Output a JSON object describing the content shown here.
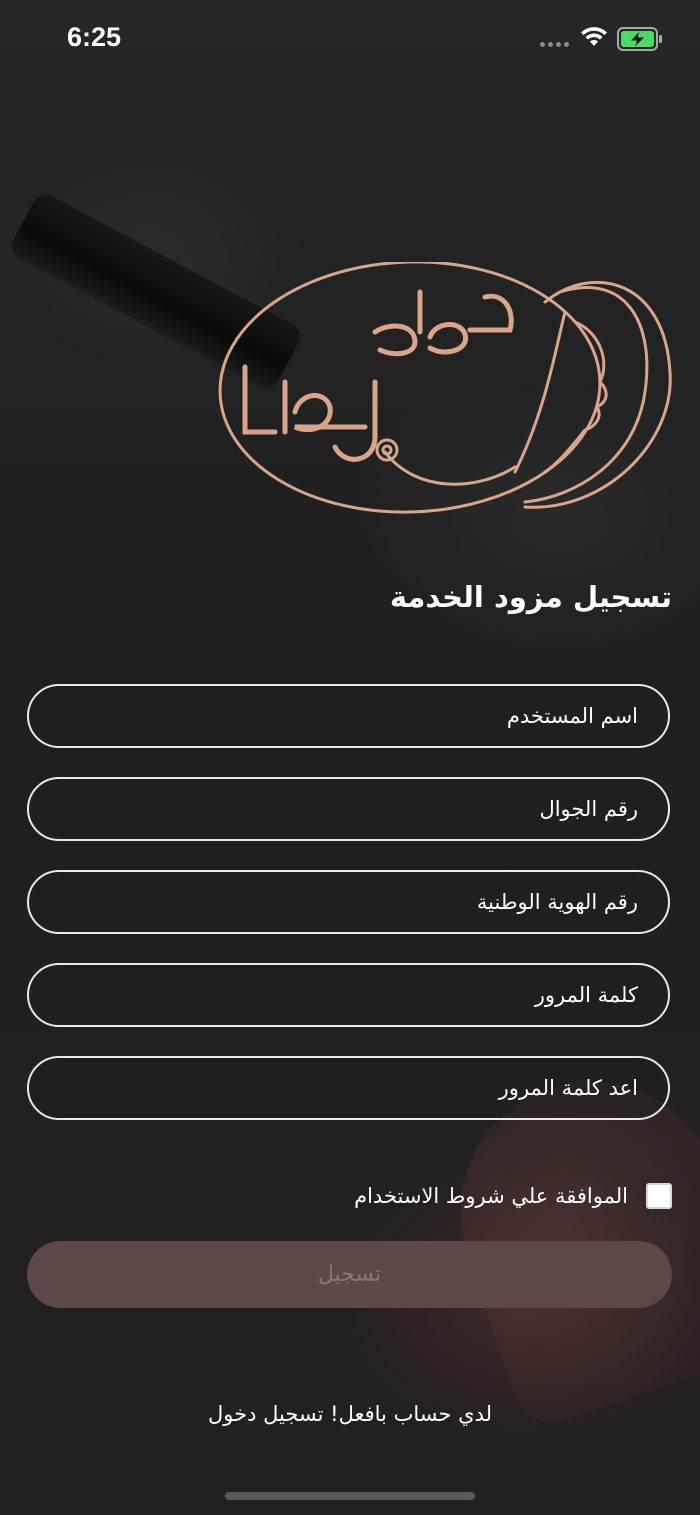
{
  "status_bar": {
    "time": "6:25"
  },
  "logo": {
    "text_line1": "طوق",
    "text_line2": "الجمال"
  },
  "form": {
    "title": "تسجيل مزود الخدمة",
    "fields": [
      {
        "placeholder": "اسم المستخدم",
        "value": ""
      },
      {
        "placeholder": "رقم الجوال",
        "value": ""
      },
      {
        "placeholder": "رقم الهوية الوطنية",
        "value": ""
      },
      {
        "placeholder": "كلمة المرور",
        "value": ""
      },
      {
        "placeholder": "اعد كلمة المرور",
        "value": ""
      }
    ],
    "terms_label": "الموافقة علي شروط الاستخدام",
    "terms_checked": false,
    "submit_label": "تسجيل",
    "login_link": "لدي حساب بافعل! تسجيل دخول"
  },
  "colors": {
    "accent": "#d9a58a",
    "background": "#202020",
    "button_disabled": "#5c4844",
    "battery": "#4cd964"
  }
}
